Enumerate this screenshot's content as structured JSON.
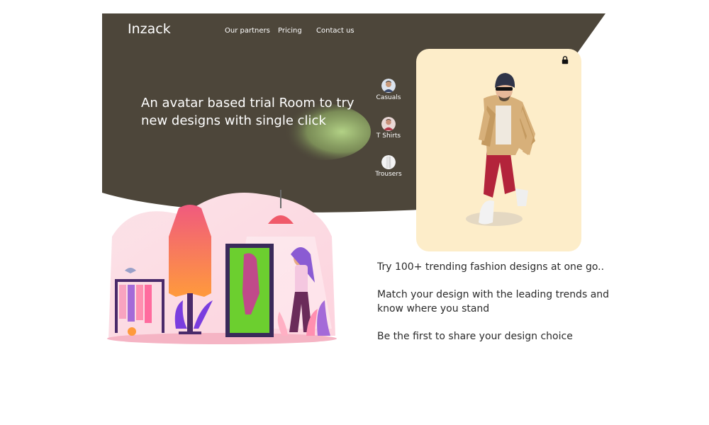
{
  "brand": {
    "logo": "Inzack"
  },
  "nav": {
    "items": [
      {
        "label": "Our partners"
      },
      {
        "label": "Pricing"
      },
      {
        "label": "Contact us"
      }
    ]
  },
  "hero": {
    "headline": "An avatar based trial Room to try new designs with single click"
  },
  "categories": [
    {
      "label": "Casuals",
      "icon": "casual-avatar-icon"
    },
    {
      "label": "T Shirts",
      "icon": "tshirt-avatar-icon"
    },
    {
      "label": "Trousers",
      "icon": "trousers-avatar-icon"
    }
  ],
  "features": [
    "Try 100+ trending fashion designs at one go..",
    "Match your design with the leading trends and know where you stand",
    "Be the first to share your design choice"
  ],
  "colors": {
    "hero_bg": "#4d463a",
    "card_bg": "#fdedc9",
    "accent_pink": "#f06a8c",
    "accent_green": "#6ccf2f",
    "accent_purple": "#7a3ddf"
  }
}
